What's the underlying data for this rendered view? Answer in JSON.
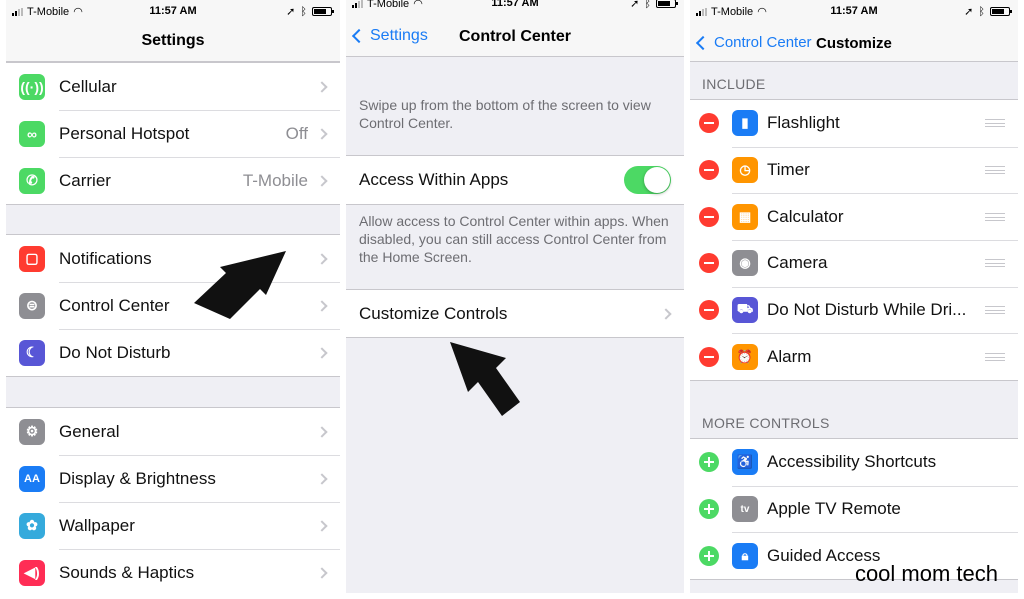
{
  "status": {
    "carrier": "T-Mobile",
    "time": "11:57 AM"
  },
  "panel1": {
    "title": "Settings",
    "group1": [
      {
        "label": "Cellular",
        "value": "",
        "icon": "antenna-icon",
        "color": "#4cd964"
      },
      {
        "label": "Personal Hotspot",
        "value": "Off",
        "icon": "hotspot-icon",
        "color": "#4cd964"
      },
      {
        "label": "Carrier",
        "value": "T-Mobile",
        "icon": "phone-icon",
        "color": "#4cd964"
      }
    ],
    "group2": [
      {
        "label": "Notifications",
        "value": "",
        "icon": "notifications-icon",
        "color": "#ff3b30"
      },
      {
        "label": "Control Center",
        "value": "",
        "icon": "switches-icon",
        "color": "#8e8e93"
      },
      {
        "label": "Do Not Disturb",
        "value": "",
        "icon": "moon-icon",
        "color": "#5856d6"
      }
    ],
    "group3": [
      {
        "label": "General",
        "value": "",
        "icon": "gear-icon",
        "color": "#8e8e93"
      },
      {
        "label": "Display & Brightness",
        "value": "",
        "icon": "text-size-icon",
        "color": "#1a7cf5"
      },
      {
        "label": "Wallpaper",
        "value": "",
        "icon": "flower-icon",
        "color": "#35aadc"
      },
      {
        "label": "Sounds & Haptics",
        "value": "",
        "icon": "speaker-icon",
        "color": "#ff2d55"
      }
    ]
  },
  "panel2": {
    "back": "Settings",
    "title": "Control Center",
    "intro": "Swipe up from the bottom of the screen to view Control Center.",
    "access_label": "Access Within Apps",
    "access_on": true,
    "access_note": "Allow access to Control Center within apps. When disabled, you can still access Control Center from the Home Screen.",
    "customize_label": "Customize Controls"
  },
  "panel3": {
    "back": "Control Center",
    "title": "Customize",
    "include_header": "INCLUDE",
    "include": [
      {
        "label": "Flashlight",
        "icon": "flashlight-icon",
        "color": "#1a7cf5"
      },
      {
        "label": "Timer",
        "icon": "timer-icon",
        "color": "#ff9500"
      },
      {
        "label": "Calculator",
        "icon": "calculator-icon",
        "color": "#ff9500"
      },
      {
        "label": "Camera",
        "icon": "camera-icon",
        "color": "#8e8e93"
      },
      {
        "label": "Do Not Disturb While Dri...",
        "icon": "car-icon",
        "color": "#5856d6"
      },
      {
        "label": "Alarm",
        "icon": "alarm-icon",
        "color": "#ff9500"
      }
    ],
    "more_header": "MORE CONTROLS",
    "more": [
      {
        "label": "Accessibility Shortcuts",
        "icon": "accessibility-icon",
        "color": "#1a7cf5"
      },
      {
        "label": "Apple TV Remote",
        "icon": "apple-tv-icon",
        "color": "#8e8e93"
      },
      {
        "label": "Guided Access",
        "icon": "lock-icon",
        "color": "#1a7cf5"
      }
    ]
  },
  "watermark": "cool mom tech"
}
